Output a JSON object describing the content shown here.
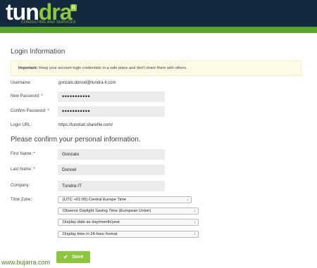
{
  "brand": {
    "logo_part1": "tun",
    "logo_part2": "dra",
    "logo_sup": "it",
    "logo_tagline": "CONSULTING AND SERVICES"
  },
  "login_section": {
    "title": "Login Information",
    "notice_bold": "Important:",
    "notice_text": " Keep your account login credentials in a safe place and don't share them with others.",
    "username_label": "Username:",
    "username_value": "gonzalo.doncel@tundra-it.com",
    "new_password_label": "New Password: *",
    "new_password_value": "•••••••••••",
    "confirm_password_label": "Confirm Password: *",
    "confirm_password_value": "•••••••••••",
    "login_url_label": "Login URL:",
    "login_url_value": "https://tundrait.sharefile.com/"
  },
  "personal_section": {
    "title": "Please confirm your personal information.",
    "first_name_label": "First Name: *",
    "first_name_value": "Gonzalo",
    "last_name_label": "Last Name: *",
    "last_name_value": "Doncel",
    "company_label": "Company:",
    "company_value": "Tundra IT",
    "time_zone_label": "Time Zone:",
    "time_zone_value": "(UTC +01:00) Central Europe Time",
    "dst_value": "Observe Daylight Saving Time (European Union)",
    "date_format_value": "Display date as day/month/year",
    "time_format_value": "Display time in 24-hour format"
  },
  "actions": {
    "save_label": "Save"
  },
  "watermark": "www.bujarra.com",
  "colors": {
    "header_bg": "#15293e",
    "accent_green": "#5aa62b",
    "button_green": "#8cc63f"
  }
}
